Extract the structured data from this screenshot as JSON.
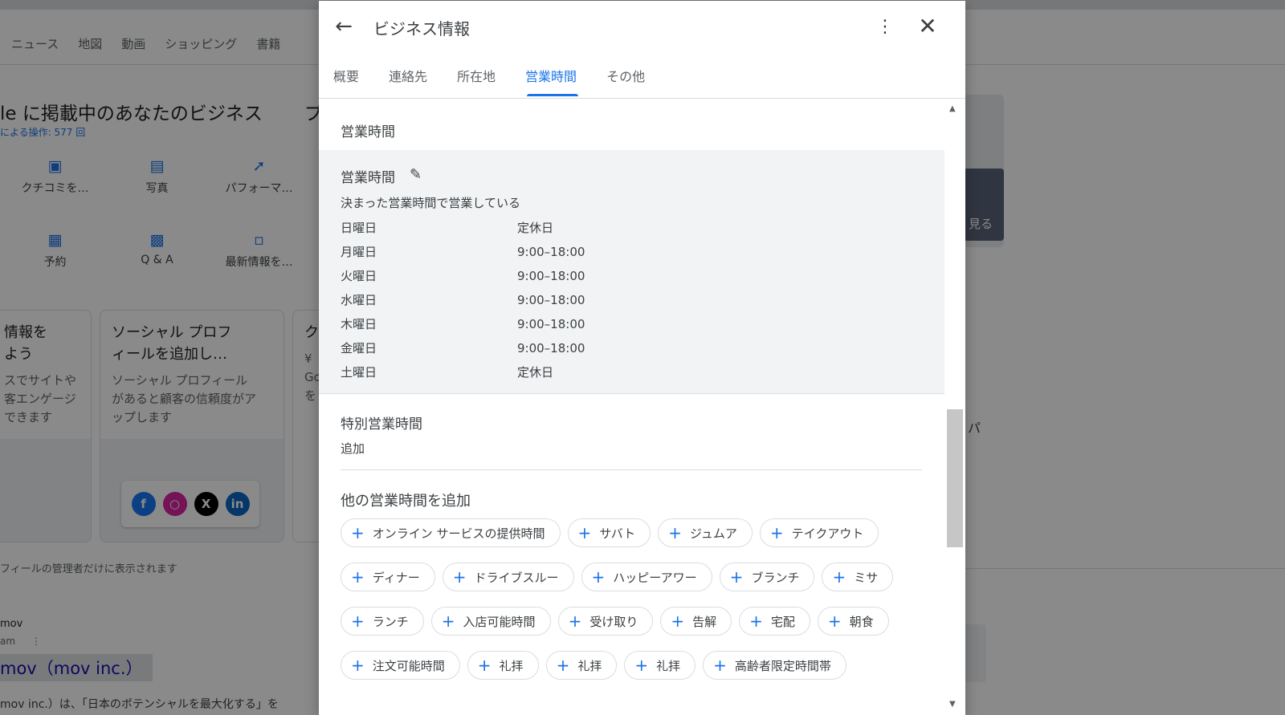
{
  "background": {
    "nav": [
      "ニュース",
      "地図",
      "動画",
      "ショッピング",
      "書籍"
    ],
    "heading": "le に掲載中のあなたのビジネス",
    "heading_extra": "プ",
    "subtext": "による操作: 577 回",
    "actions": [
      {
        "label": "クチコミを…",
        "icon": "review-icon"
      },
      {
        "label": "写真",
        "icon": "photo-icon"
      },
      {
        "label": "パフォーマ…",
        "icon": "performance-icon"
      },
      {
        "label": "予約",
        "icon": "calendar-icon"
      },
      {
        "label": "Q & A",
        "icon": "qa-icon"
      },
      {
        "label": "最新情報を…",
        "icon": "post-icon"
      }
    ],
    "card1": {
      "title": "情報を\nよう",
      "desc": "スでサイトや\n客エンゲージ\nできます"
    },
    "card2": {
      "title": "ソーシャル プロフ\nィールを追加し…",
      "desc": "ソーシャル プロフィール\nがあると顧客の信頼度がア\nップします"
    },
    "card3": {
      "title": "ク",
      "desc": "¥\nGo\nを"
    },
    "note": "フィールの管理者だけに表示されます",
    "mov_small": "mov",
    "mov_sub": "am",
    "mov_big": "mov（mov inc.）",
    "mov_desc": "mov inc.）は、「日本のポテンシャルを最大化する」を",
    "right_image_text": "見る",
    "right_text": "パ"
  },
  "dialog": {
    "title": "ビジネス情報",
    "tabs": [
      "概要",
      "連絡先",
      "所在地",
      "営業時間",
      "その他"
    ],
    "active_tab": "営業時間",
    "section_title": "営業時間",
    "hours": {
      "label": "営業時間",
      "description": "決まった営業時間で営業している",
      "rows": [
        {
          "day": "日曜日",
          "time": "定休日"
        },
        {
          "day": "月曜日",
          "time": "9:00–18:00"
        },
        {
          "day": "火曜日",
          "time": "9:00–18:00"
        },
        {
          "day": "水曜日",
          "time": "9:00–18:00"
        },
        {
          "day": "木曜日",
          "time": "9:00–18:00"
        },
        {
          "day": "金曜日",
          "time": "9:00–18:00"
        },
        {
          "day": "土曜日",
          "time": "定休日"
        }
      ]
    },
    "special": {
      "title": "特別営業時間",
      "add": "追加"
    },
    "other": {
      "title": "他の営業時間を追加",
      "chip_rows": [
        [
          "オンライン サービスの提供時間",
          "サバト",
          "ジュムア",
          "テイクアウト"
        ],
        [
          "ディナー",
          "ドライブスルー",
          "ハッピーアワー",
          "ブランチ",
          "ミサ"
        ],
        [
          "ランチ",
          "入店可能時間",
          "受け取り",
          "告解",
          "宅配",
          "朝食"
        ],
        [
          "注文可能時間",
          "礼拝",
          "礼拝",
          "礼拝",
          "高齢者限定時間帯"
        ]
      ]
    }
  },
  "colors": {
    "accent": "#1a73e8",
    "text": "#3c4043",
    "muted": "#5f6368",
    "panel": "#f1f3f4"
  }
}
